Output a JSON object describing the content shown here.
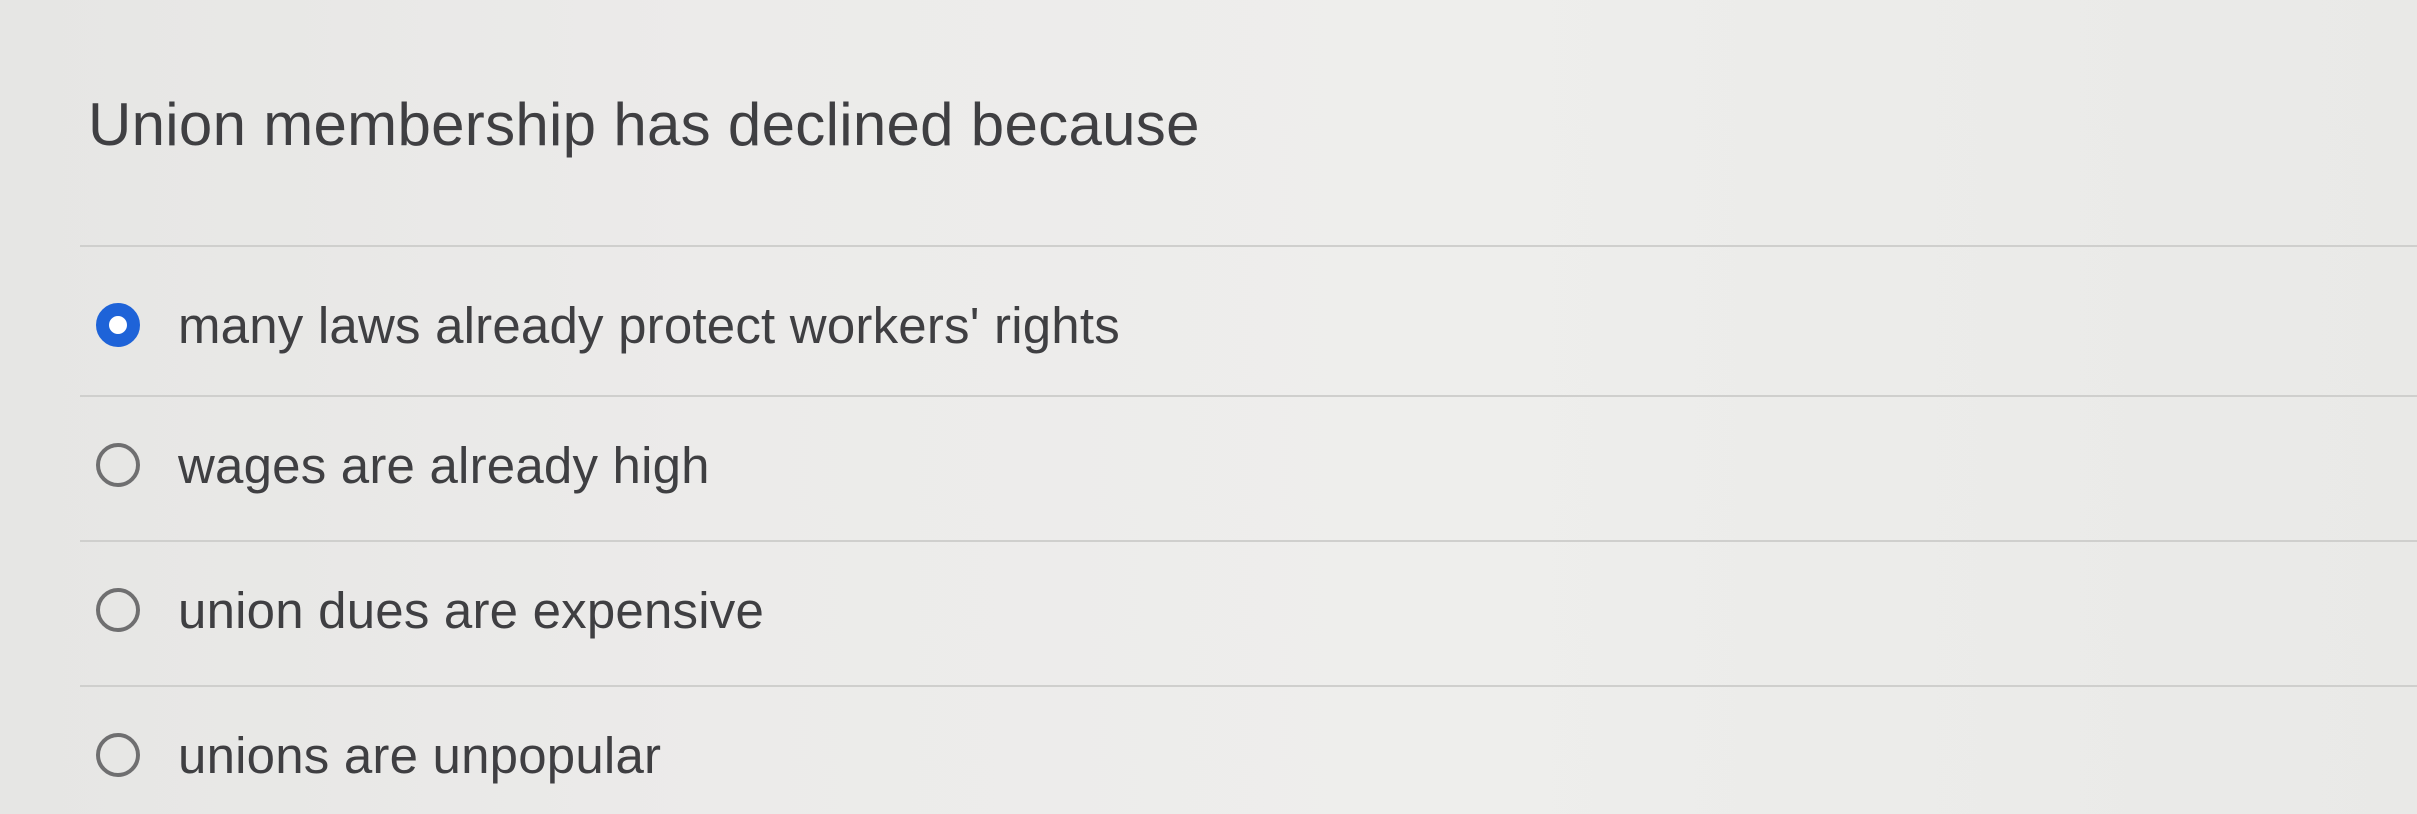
{
  "question": {
    "text": "Union membership has declined because"
  },
  "options": [
    {
      "label": "many laws already protect workers' rights",
      "selected": true
    },
    {
      "label": "wages are already high",
      "selected": false
    },
    {
      "label": "union dues are expensive",
      "selected": false
    },
    {
      "label": "unions are unpopular",
      "selected": false
    }
  ],
  "colors": {
    "selected_radio": "#1e63d8",
    "text": "#3f3f42"
  }
}
